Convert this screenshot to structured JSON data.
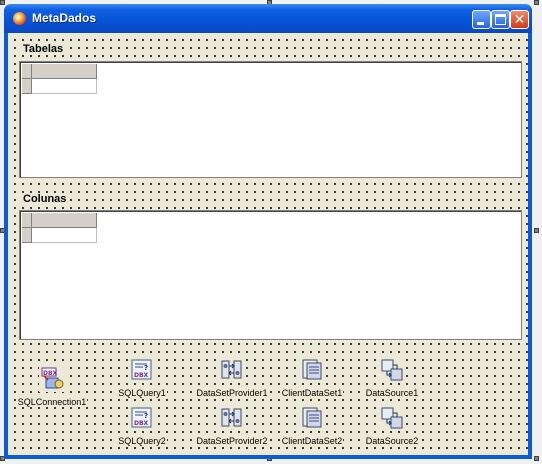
{
  "window": {
    "title": "MetaDados",
    "title_color": "#ffffff",
    "accent": "#0a5bd6"
  },
  "sections": {
    "tabelas_label": "Tabelas",
    "colunas_label": "Colunas"
  },
  "components": [
    {
      "label": "SQLConnection1",
      "icon": "sql-connection-icon"
    },
    {
      "label": "SQLQuery1",
      "icon": "sql-query-icon"
    },
    {
      "label": "DataSetProvider1",
      "icon": "dataset-provider-icon"
    },
    {
      "label": "ClientDataSet1",
      "icon": "client-dataset-icon"
    },
    {
      "label": "DataSource1",
      "icon": "datasource-icon"
    },
    {
      "label": "SQLQuery2",
      "icon": "sql-query-icon"
    },
    {
      "label": "DataSetProvider2",
      "icon": "dataset-provider-icon"
    },
    {
      "label": "ClientDataSet2",
      "icon": "client-dataset-icon"
    },
    {
      "label": "DataSource2",
      "icon": "datasource-icon"
    }
  ]
}
